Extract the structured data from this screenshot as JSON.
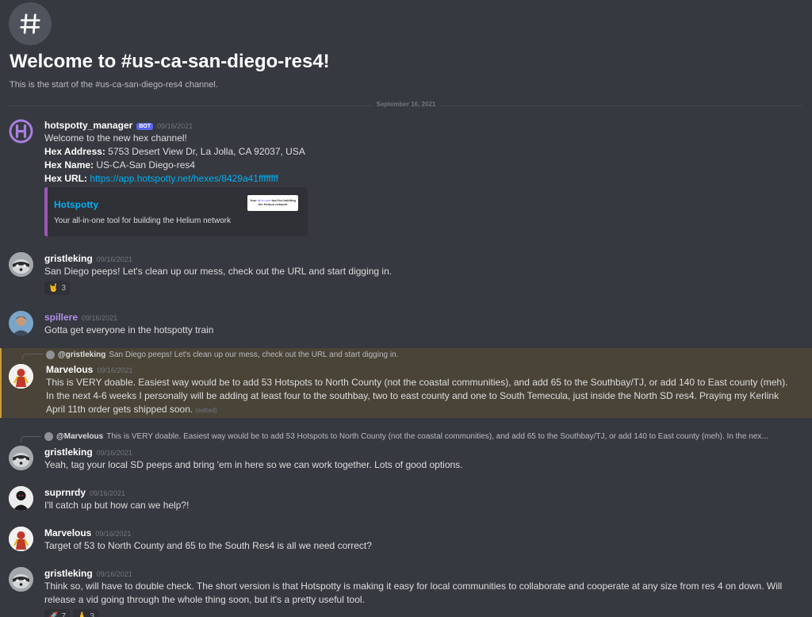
{
  "channel": {
    "hash_glyph": "#",
    "welcome_title": "Welcome to #us-ca-san-diego-res4!",
    "welcome_subtitle": "This is the start of the #us-ca-san-diego-res4 channel."
  },
  "date_divider": "September 16, 2021",
  "colors": {
    "background": "#36393f",
    "link": "#00aff4",
    "highlight": "#4a4438",
    "bot_badge": "#5865f2"
  },
  "messages": [
    {
      "author": "hotspotty_manager",
      "badge": "BOT",
      "time": "09/16/2021",
      "line1": "Welcome to the new hex channel!",
      "hex_address_label": "Hex Address:",
      "hex_address": "5753 Desert View Dr, La Jolla, CA 92037, USA",
      "hex_name_label": "Hex Name:",
      "hex_name": "US-CA-San Diego-res4",
      "hex_url_label": "Hex URL:",
      "hex_url": "https://app.hotspotty.net/hexes/8429a41ffffffff",
      "embed": {
        "title": "Hotspotty",
        "description": "Your all-in-one tool for building the Helium network",
        "thumb_prefix": "Your ",
        "thumb_accent": "all-in-one",
        "thumb_suffix": " tool for building the Helium network"
      }
    },
    {
      "author": "gristleking",
      "time": "09/16/2021",
      "text": "San Diego peeps!  Let's clean up our mess, check out the URL and start digging in.",
      "reaction": {
        "icon": "🤘",
        "count": "3"
      }
    },
    {
      "author": "spillere",
      "time": "09/16/2021",
      "text": "Gotta get everyone in the hotspotty train"
    },
    {
      "reply_to_user": "@gristleking",
      "reply_to_text": "San Diego peeps!  Let's clean up our mess, check out the URL and start digging in.",
      "author": "Marvelous",
      "time": "09/16/2021",
      "line1": "This is VERY doable. Easiest way would be to add 53 Hotspots to North County (not the coastal communities), and add 65 to the Southbay/TJ, or add 140 to East county (meh).",
      "line2": "In the next 4-6 weeks I personally will be adding at least four to the southbay, two to east county and one to South Temecula, just inside the North SD res4. Praying my Kerlink April 11th order gets shipped soon.",
      "edited": "(edited)"
    },
    {
      "reply_to_user": "@Marvelous",
      "reply_to_text": "This is VERY doable. Easiest way would be to add 53 Hotspots to North County (not the coastal communities), and add 65 to the Southbay/TJ, or add 140 to East county (meh).  In the nex...",
      "author": "gristleking",
      "time": "09/16/2021",
      "text": "Yeah, tag your local SD peeps and bring 'em in here so we can work together.  Lots of good options."
    },
    {
      "author": "suprnrdy",
      "time": "09/16/2021",
      "text": "I'll catch up but how can we help?!"
    },
    {
      "author": "Marvelous",
      "time": "09/16/2021",
      "text": "Target of 53 to North County and 65 to the South Res4 is all we need correct?"
    },
    {
      "author": "gristleking",
      "time": "09/16/2021",
      "text": "Think so, will have to double check.  The short version is that Hotspotty is making it easy for local communities to collaborate and cooperate at any size from res 4 on down.  Will release a vid going through the whole thing soon, but it's a pretty useful tool.",
      "reactions": [
        {
          "icon": "🚀",
          "count": "7"
        },
        {
          "icon": "🙏",
          "count": "3"
        }
      ]
    }
  ]
}
